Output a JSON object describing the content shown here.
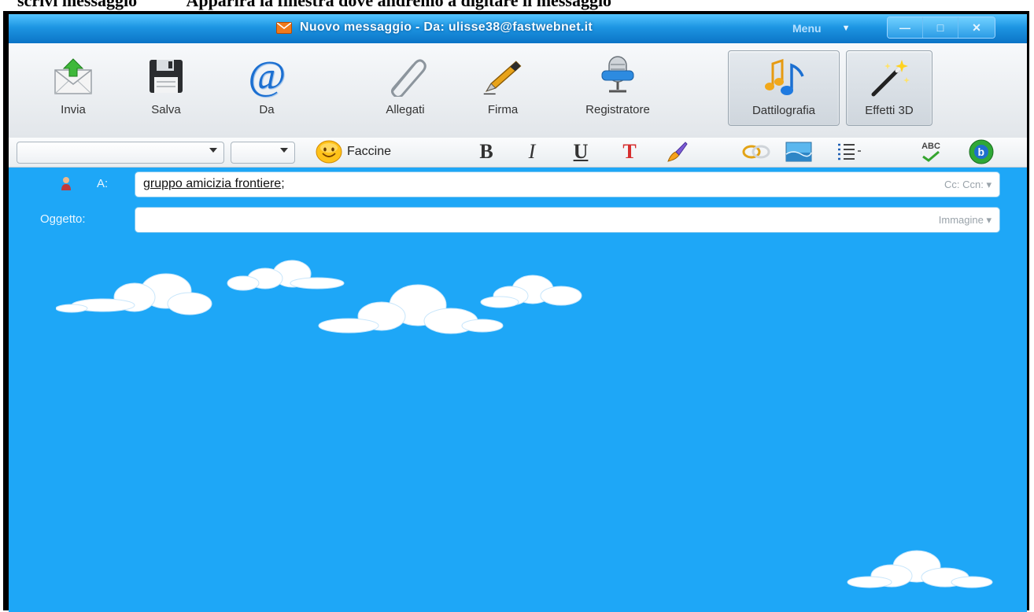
{
  "caption": {
    "left": "scrivi messaggio",
    "right": "Apparirà la finestra dove andremo a digitare il messaggio"
  },
  "window": {
    "title": "Nuovo messaggio - Da: ulisse38@fastwebnet.it",
    "menu_label": "Menu",
    "controls": {
      "minimize": "—",
      "maximize": "□",
      "close": "✕"
    }
  },
  "toolbar": {
    "send": "Invia",
    "save": "Salva",
    "from": "Da",
    "attachments": "Allegati",
    "signature": "Firma",
    "recorder": "Registratore",
    "typing": "Dattilografia",
    "effects": "Effetti 3D"
  },
  "format_bar": {
    "font_family": "",
    "font_size": "",
    "emoticons": "Faccine",
    "bold": "B",
    "italic": "I",
    "underline": "U",
    "text_color": "T",
    "spellcheck": "ABC"
  },
  "header": {
    "to_label": "A:",
    "to_value": "gruppo amicizia frontiere",
    "to_separator": ";",
    "cc_label": "Cc: Ccn: ▾",
    "subject_label": "Oggetto:",
    "subject_value": "",
    "image_label": "Immagine ▾"
  },
  "colors": {
    "background": "#1ea7f7",
    "titlebar": "#1d95e2",
    "toolbar": "#e8ecef"
  },
  "icons": {
    "send": "envelope-arrow-icon",
    "save": "floppy-disk-icon",
    "from": "at-sign-icon",
    "attachments": "paperclip-icon",
    "signature": "pen-icon",
    "recorder": "microphone-icon",
    "typing": "music-notes-icon",
    "effects": "magic-wand-icon"
  }
}
